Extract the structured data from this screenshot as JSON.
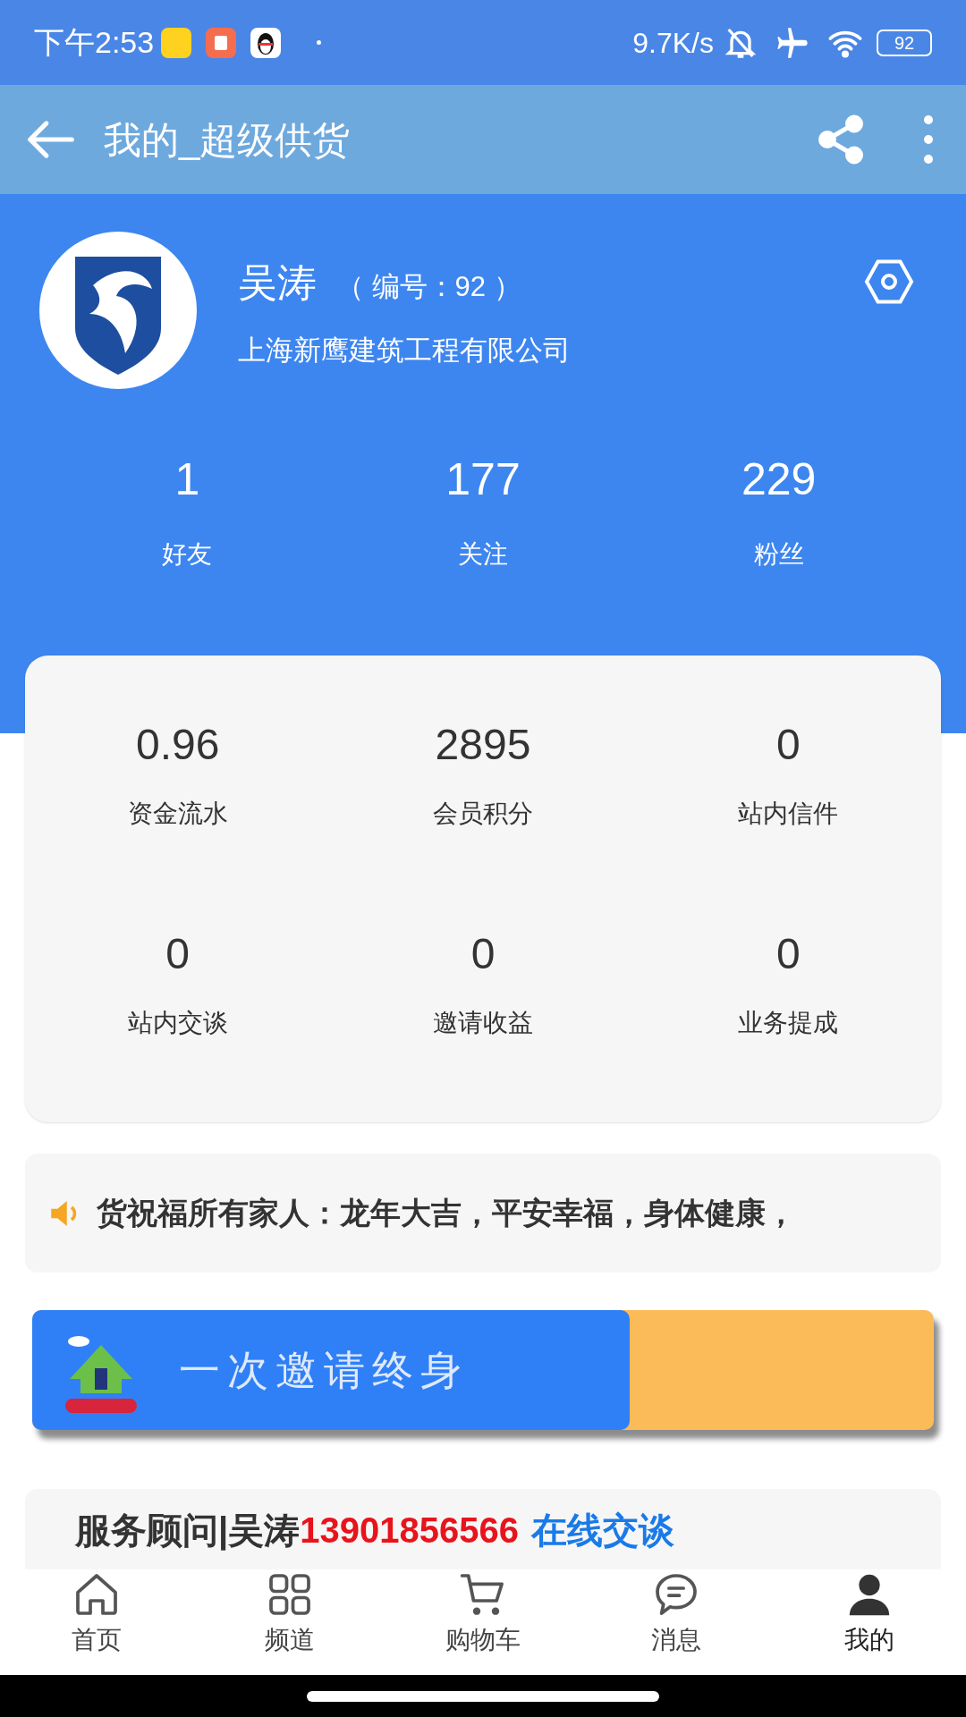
{
  "status_bar": {
    "time": "下午2:53",
    "speed": "9.7K/s",
    "battery": "92"
  },
  "title_bar": {
    "title": "我的_超级供货"
  },
  "profile": {
    "name": "吴涛",
    "member_no": "（ 编号：92 ）",
    "company": "上海新鹰建筑工程有限公司"
  },
  "social_stats": [
    {
      "value": "1",
      "label": "好友"
    },
    {
      "value": "177",
      "label": "关注"
    },
    {
      "value": "229",
      "label": "粉丝"
    }
  ],
  "account_stats": [
    {
      "value": "0.96",
      "label": "资金流水"
    },
    {
      "value": "2895",
      "label": "会员积分"
    },
    {
      "value": "0",
      "label": "站内信件"
    },
    {
      "value": "0",
      "label": "站内交谈"
    },
    {
      "value": "0",
      "label": "邀请收益"
    },
    {
      "value": "0",
      "label": "业务提成"
    }
  ],
  "notice": {
    "text": "货祝福所有家人：龙年大吉，平安幸福，身体健康，"
  },
  "banner": {
    "text": "一次邀请终身"
  },
  "service": {
    "label": "服务顾问|吴涛",
    "phone": "13901856566",
    "link": "在线交谈"
  },
  "bottom_nav": [
    {
      "label": "首页",
      "kind": "home",
      "selected": false
    },
    {
      "label": "频道",
      "kind": "grid",
      "selected": false
    },
    {
      "label": "购物车",
      "kind": "cart",
      "selected": false
    },
    {
      "label": "消息",
      "kind": "chat",
      "selected": false
    },
    {
      "label": "我的",
      "kind": "user",
      "selected": true
    }
  ]
}
